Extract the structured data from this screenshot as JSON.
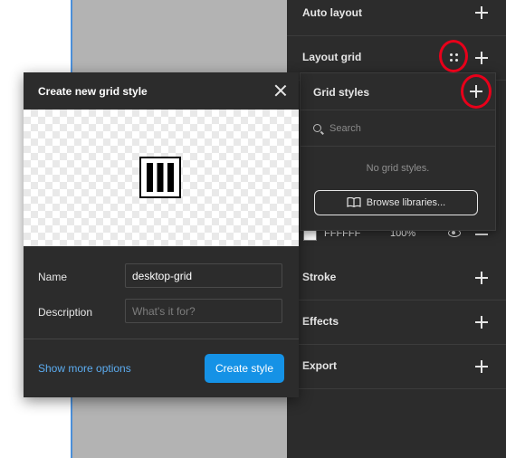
{
  "panel": {
    "auto_layout": "Auto layout",
    "layout_grid": "Layout grid",
    "stroke": "Stroke",
    "effects": "Effects",
    "export": "Export",
    "fill": {
      "hex": "FFFFFF",
      "opacity": "100%"
    }
  },
  "grid_styles": {
    "title": "Grid styles",
    "search_placeholder": "Search",
    "empty": "No grid styles.",
    "browse": "Browse libraries..."
  },
  "dialog": {
    "title": "Create new grid style",
    "name_label": "Name",
    "name_value": "desktop-grid",
    "description_label": "Description",
    "description_placeholder": "What's it for?",
    "more_options": "Show more options",
    "create_button": "Create style"
  },
  "colors": {
    "panel_bg": "#2c2c2c",
    "accent": "#1592e6",
    "link": "#5cacf0",
    "annotation": "#e8001a",
    "canvas_gray": "#b3b3b3"
  }
}
